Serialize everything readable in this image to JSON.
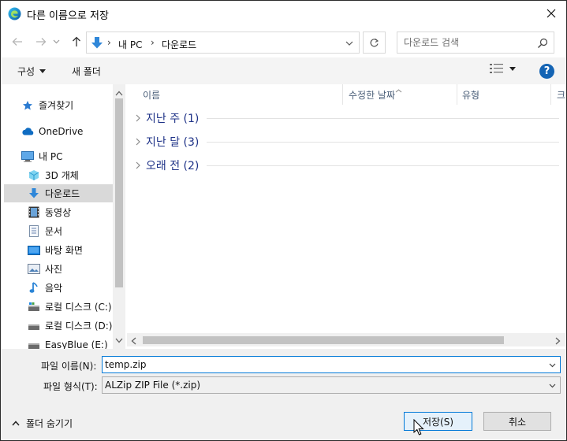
{
  "window": {
    "title": "다른 이름으로 저장",
    "app_icon": "edge-icon",
    "close_icon": "close-icon"
  },
  "nav": {
    "back_icon": "arrow-left-icon",
    "forward_icon": "arrow-right-icon",
    "recent_icon": "chevron-down-icon",
    "up_icon": "arrow-up-icon",
    "breadcrumbs": [
      "내 PC",
      "다운로드"
    ],
    "refresh_icon": "refresh-icon",
    "search_placeholder": "다운로드 검색",
    "search_icon": "search-icon"
  },
  "toolbar": {
    "organize": "구성",
    "new_folder": "새 폴더",
    "view_icon": "details-view-icon",
    "help": "?"
  },
  "sidebar": {
    "items": [
      {
        "label": "즐겨찾기",
        "icon": "star-icon",
        "level": 0
      },
      {
        "label": "OneDrive",
        "icon": "cloud-icon",
        "level": 0
      },
      {
        "label": "내 PC",
        "icon": "computer-icon",
        "level": 0
      },
      {
        "label": "3D 개체",
        "icon": "cube-icon",
        "level": 1
      },
      {
        "label": "다운로드",
        "icon": "download-icon",
        "level": 1,
        "selected": true
      },
      {
        "label": "동영상",
        "icon": "film-icon",
        "level": 1
      },
      {
        "label": "문서",
        "icon": "document-icon",
        "level": 1
      },
      {
        "label": "바탕 화면",
        "icon": "desktop-icon",
        "level": 1
      },
      {
        "label": "사진",
        "icon": "picture-icon",
        "level": 1
      },
      {
        "label": "음악",
        "icon": "music-icon",
        "level": 1
      },
      {
        "label": "로컬 디스크 (C:)",
        "icon": "drive-icon",
        "level": 1
      },
      {
        "label": "로컬 디스크 (D:)",
        "icon": "drive-icon",
        "level": 1
      },
      {
        "label": "EasyBlue (E:)",
        "icon": "drive-icon",
        "level": 1
      }
    ]
  },
  "columns": [
    "이름",
    "수정한 날짜",
    "유형",
    "크"
  ],
  "groups": [
    {
      "label": "지난 주 (1)"
    },
    {
      "label": "지난 달 (3)"
    },
    {
      "label": "오래 전 (2)"
    }
  ],
  "bottom": {
    "filename_label": "파일 이름(N):",
    "filename_value": "temp.zip",
    "filetype_label": "파일 형식(T):",
    "filetype_value": "ALZip ZIP File (*.zip)",
    "hide_folders": "폴더 숨기기",
    "save": "저장(S)",
    "cancel": "취소"
  },
  "colors": {
    "accent": "#0078d7",
    "group_text": "#1e3287",
    "column_text": "#4c607a",
    "selected_bg": "#d9d9d9",
    "help_bg": "#1464b4"
  }
}
